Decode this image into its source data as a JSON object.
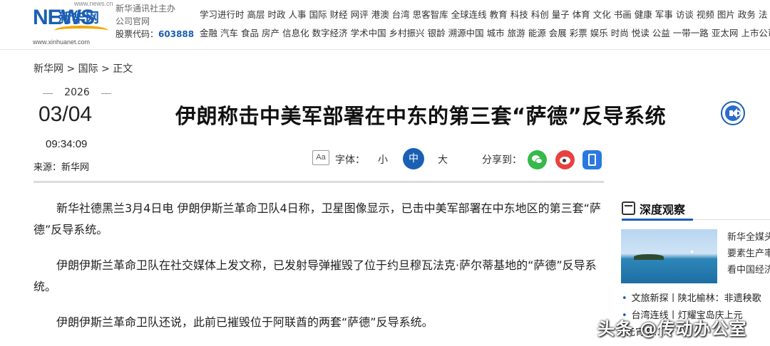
{
  "header": {
    "logo_text": "新华网",
    "logo_news": "NEWS",
    "logo_url": "www.xinhuanet.com",
    "logo_url_top": "www.news.cn",
    "host_line1": "新华通讯社主办",
    "host_line2": "公司官网",
    "stock_label": "股票代码：",
    "stock_code": "603888",
    "nav_row1": [
      "学习进行时",
      "高层",
      "时政",
      "人事",
      "国际",
      "财经",
      "网评",
      "港澳",
      "台湾",
      "思客智库",
      "全球连线",
      "教育",
      "科技",
      "科创",
      "量子",
      "体育",
      "文化",
      "书画",
      "健康",
      "军事",
      "访谈",
      "视频",
      "图片",
      "政务",
      "法"
    ],
    "nav_row2": [
      "金融",
      "汽车",
      "食品",
      "房产",
      "信息化",
      "数字经济",
      "学术中国",
      "乡村振兴",
      "银龄",
      "溯源中国",
      "城市",
      "旅游",
      "能源",
      "会展",
      "彩票",
      "娱乐",
      "时尚",
      "悦读",
      "公益",
      "一带一路",
      "亚太网",
      "上市公司"
    ]
  },
  "breadcrumb": "新华网 > 国际 > 正文",
  "date": {
    "year": "2026",
    "month_day": "03/04",
    "time": "09:34:09",
    "source": "来源：新华网"
  },
  "article": {
    "title": "伊朗称击中美军部署在中东的第三套“萨德”反导系统",
    "paragraphs": [
      "新华社德黑兰3月4日电 伊朗伊斯兰革命卫队4日称，卫星图像显示，已击中美军部署在中东地区的第三套“萨德”反导系统。",
      "伊朗伊斯兰革命卫队在社交媒体上发文称，已发射导弹摧毁了位于约旦穆瓦法克·萨尔蒂基地的“萨德”反导系统。",
      "伊朗伊斯兰革命卫队还说，此前已摧毁位于阿联酋的两套“萨德”反导系统。"
    ]
  },
  "tools": {
    "aa_icon": "Aa",
    "font_label": "字体：",
    "font_small": "小",
    "font_mid": "中",
    "font_big": "大",
    "share_label": "分享到："
  },
  "sidebar": {
    "title": "深度观察",
    "thumb_text": [
      "新华全媒头",
      "要素生产率",
      "看中国经济"
    ],
    "items": [
      "文旅新探丨陕北榆林：非遗秧歌",
      "台湾连线丨灯耀宝岛庆上元",
      "元宵节……"
    ]
  },
  "watermark": "头条 @传动办公室"
}
